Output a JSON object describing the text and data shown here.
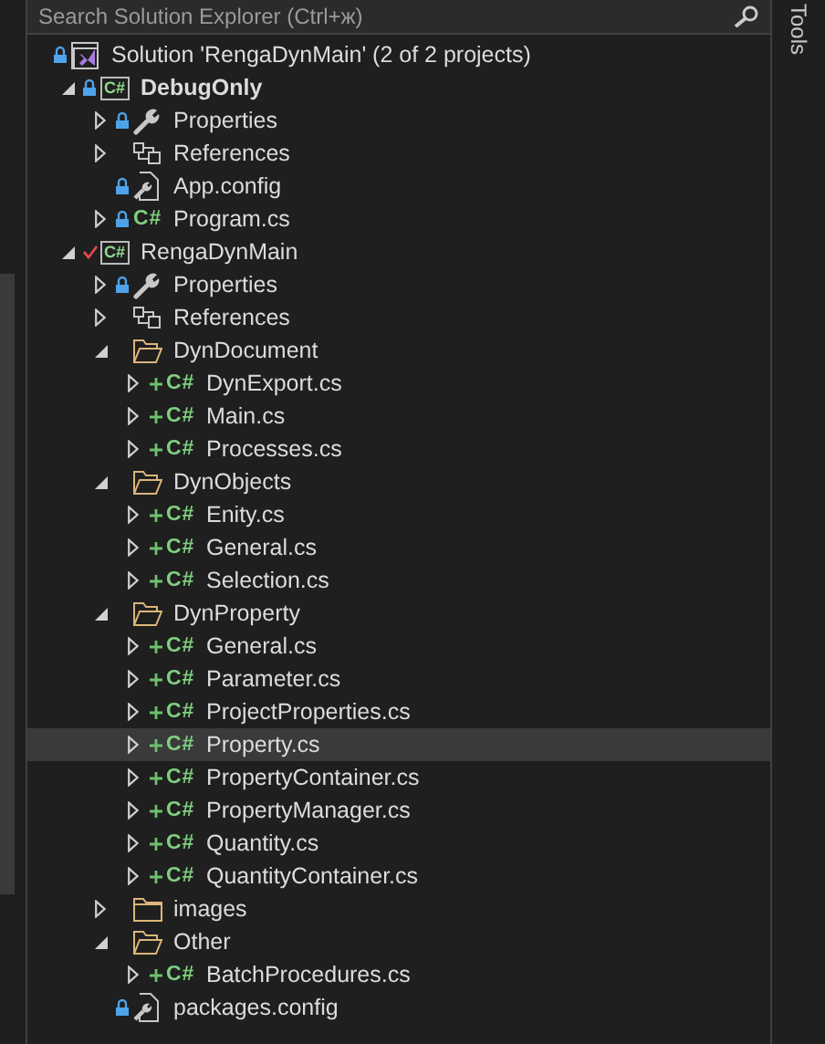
{
  "search": {
    "placeholder": "Search Solution Explorer (Ctrl+ж)"
  },
  "tree": [
    {
      "label": "Solution 'RengaDynMain' (2 of 2 projects)",
      "kind": "solution",
      "locked": true,
      "selected": false,
      "children": [
        {
          "label": "DebugOnly",
          "kind": "project",
          "icon_text": "C#",
          "locked": true,
          "startup": true,
          "expanded": true,
          "selected": false,
          "children": [
            {
              "label": "Properties",
              "kind": "properties",
              "locked": true,
              "expanded": false,
              "selected": false
            },
            {
              "label": "References",
              "kind": "references",
              "expanded": false,
              "selected": false
            },
            {
              "label": "App.config",
              "kind": "config",
              "locked": true,
              "selected": false
            },
            {
              "label": "Program.cs",
              "kind": "csharp",
              "icon_text": "C#",
              "locked": true,
              "expanded": false,
              "selected": false
            }
          ]
        },
        {
          "label": "RengaDynMain",
          "kind": "project",
          "icon_text": "C#",
          "checked_out": true,
          "startup": false,
          "expanded": true,
          "selected": false,
          "children": [
            {
              "label": "Properties",
              "kind": "properties",
              "locked": true,
              "expanded": false,
              "selected": false
            },
            {
              "label": "References",
              "kind": "references",
              "expanded": false,
              "selected": false
            },
            {
              "label": "DynDocument",
              "kind": "folder",
              "expanded": true,
              "selected": false,
              "children": [
                {
                  "label": "DynExport.cs",
                  "kind": "csharp",
                  "icon_text": "C#",
                  "added": true,
                  "expanded": false,
                  "selected": false
                },
                {
                  "label": "Main.cs",
                  "kind": "csharp",
                  "icon_text": "C#",
                  "added": true,
                  "expanded": false,
                  "selected": false
                },
                {
                  "label": "Processes.cs",
                  "kind": "csharp",
                  "icon_text": "C#",
                  "added": true,
                  "expanded": false,
                  "selected": false
                }
              ]
            },
            {
              "label": "DynObjects",
              "kind": "folder",
              "expanded": true,
              "selected": false,
              "children": [
                {
                  "label": "Enity.cs",
                  "kind": "csharp",
                  "icon_text": "C#",
                  "added": true,
                  "expanded": false,
                  "selected": false
                },
                {
                  "label": "General.cs",
                  "kind": "csharp",
                  "icon_text": "C#",
                  "added": true,
                  "expanded": false,
                  "selected": false
                },
                {
                  "label": "Selection.cs",
                  "kind": "csharp",
                  "icon_text": "C#",
                  "added": true,
                  "expanded": false,
                  "selected": false
                }
              ]
            },
            {
              "label": "DynProperty",
              "kind": "folder",
              "expanded": true,
              "selected": false,
              "children": [
                {
                  "label": "General.cs",
                  "kind": "csharp",
                  "icon_text": "C#",
                  "added": true,
                  "expanded": false,
                  "selected": false
                },
                {
                  "label": "Parameter.cs",
                  "kind": "csharp",
                  "icon_text": "C#",
                  "added": true,
                  "expanded": false,
                  "selected": false
                },
                {
                  "label": "ProjectProperties.cs",
                  "kind": "csharp",
                  "icon_text": "C#",
                  "added": true,
                  "expanded": false,
                  "selected": false
                },
                {
                  "label": "Property.cs",
                  "kind": "csharp",
                  "icon_text": "C#",
                  "added": true,
                  "expanded": false,
                  "selected": true
                },
                {
                  "label": "PropertyContainer.cs",
                  "kind": "csharp",
                  "icon_text": "C#",
                  "added": true,
                  "expanded": false,
                  "selected": false
                },
                {
                  "label": "PropertyManager.cs",
                  "kind": "csharp",
                  "icon_text": "C#",
                  "added": true,
                  "expanded": false,
                  "selected": false
                },
                {
                  "label": "Quantity.cs",
                  "kind": "csharp",
                  "icon_text": "C#",
                  "added": true,
                  "expanded": false,
                  "selected": false
                },
                {
                  "label": "QuantityContainer.cs",
                  "kind": "csharp",
                  "icon_text": "C#",
                  "added": true,
                  "expanded": false,
                  "selected": false
                }
              ]
            },
            {
              "label": "images",
              "kind": "folder",
              "expanded": false,
              "selected": false
            },
            {
              "label": "Other",
              "kind": "folder",
              "expanded": true,
              "selected": false,
              "children": [
                {
                  "label": "BatchProcedures.cs",
                  "kind": "csharp",
                  "icon_text": "C#",
                  "added": true,
                  "expanded": false,
                  "selected": false
                }
              ]
            },
            {
              "label": "packages.config",
              "kind": "config",
              "locked": true,
              "selected": false
            }
          ]
        }
      ]
    }
  ],
  "side_tab": {
    "label": "Tools"
  }
}
